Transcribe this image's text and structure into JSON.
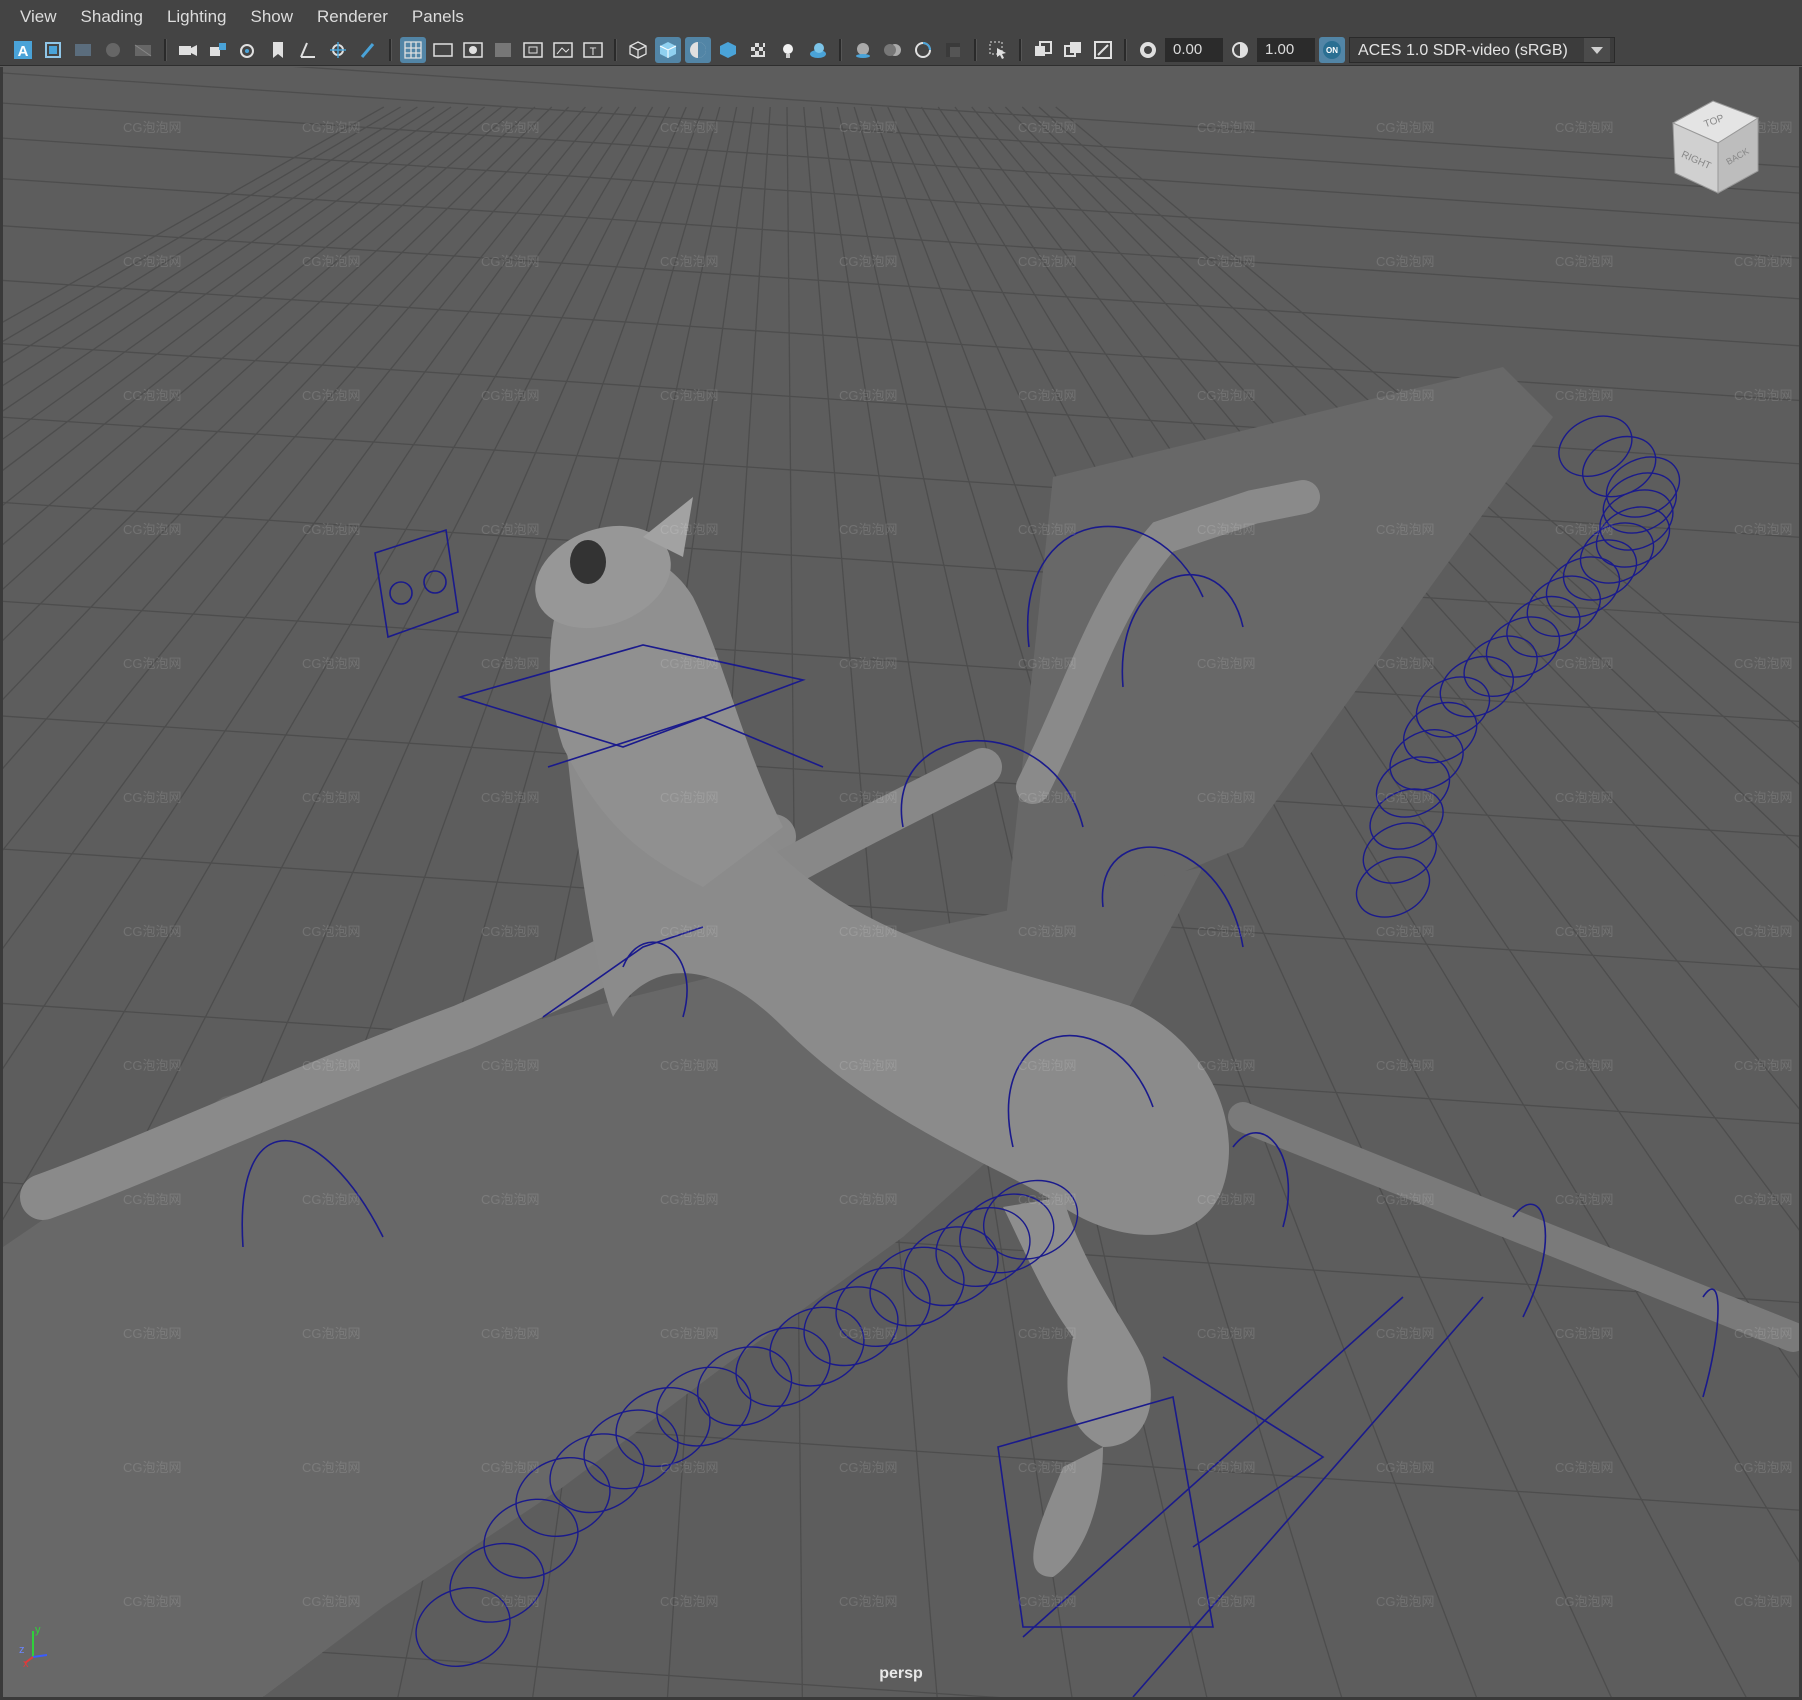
{
  "menubar": {
    "items": [
      "View",
      "Shading",
      "Lighting",
      "Show",
      "Renderer",
      "Panels"
    ]
  },
  "toolbar": {
    "exposure_value": "0.00",
    "gamma_value": "1.00",
    "color_transform": "ACES 1.0 SDR-video (sRGB)",
    "color_management_badge": "ON",
    "accent_color": "#5285a6"
  },
  "viewport": {
    "camera_label": "persp",
    "viewcube_faces": {
      "top": "TOP",
      "right": "RIGHT",
      "back": "BACK"
    },
    "axis_labels": {
      "x": "x",
      "y": "y",
      "z": "z"
    },
    "watermark_text": "CG泡泡网",
    "control_curve_color": "#1a1a8c"
  }
}
